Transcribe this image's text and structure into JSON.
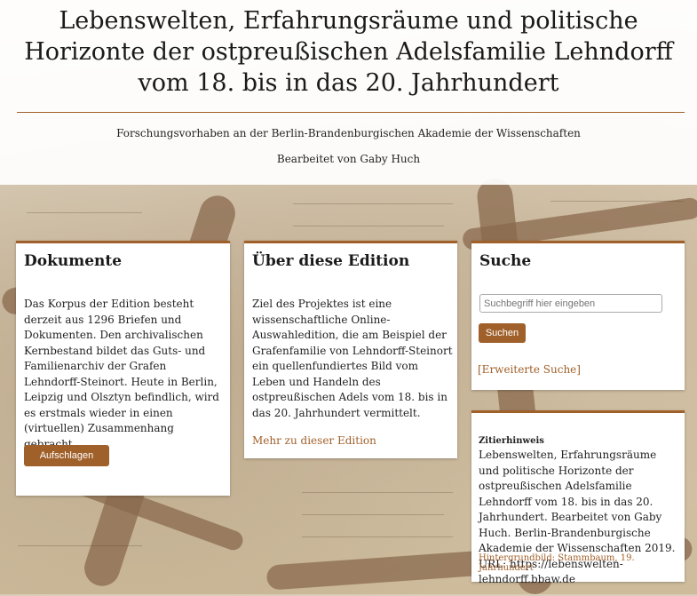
{
  "header": {
    "title_line1": "Lebenswelten, Erfahrungsräume und politische",
    "title_line2": "Horizonte der ostpreußischen Adelsfamilie Lehndorff",
    "title_line3": "vom 18. bis in das 20. Jahrhundert",
    "subtitle": "Forschungsvorhaben an der Berlin-Brandenburgischen Akademie der Wissenschaften",
    "editor": "Bearbeitet von Gaby Huch"
  },
  "documents": {
    "heading": "Dokumente",
    "text": "Das Korpus der Edition besteht derzeit aus 1296 Briefen und Dokumenten. Den archivalischen Kernbestand bildet das Guts- und Familienarchiv der Grafen Lehndorff-Steinort. Heute in Berlin, Leipzig und Olsztyn befindlich, wird es erstmals wieder in einen (virtuellen) Zusammenhang gebracht.",
    "button": "Aufschlagen"
  },
  "about": {
    "heading": "Über diese Edition",
    "text": "Ziel des Projektes ist eine wissenschaftliche Online-Auswahledition, die am Beispiel der Grafenfamilie von Lehndorff-Steinort ein quellenfundiertes Bild vom Leben und Handeln des ostpreußischen Adels vom 18. bis in das 20. Jahrhundert vermittelt.",
    "link": "Mehr zu dieser Edition"
  },
  "search": {
    "heading": "Suche",
    "placeholder": "Suchbegriff hier eingeben",
    "button": "Suchen",
    "advanced_link": "[Erweiterte Suche]"
  },
  "citation": {
    "heading": "Zitierhinweis",
    "text": "Lebenswelten, Erfahrungsräume und politische Horizonte der ostpreußischen Adelsfamilie Lehndorff vom 18. bis in das 20. Jahrhundert. Bearbeitet von Gaby Huch. Berlin-Brandenburgische Akademie der Wissenschaften 2019. URL: https://lebenswelten-lehndorff.bbaw.de",
    "background_link": "Hintergrundbild: Stammbaum, 19. Jahrhundert"
  },
  "colors": {
    "accent": "#a0602a"
  }
}
